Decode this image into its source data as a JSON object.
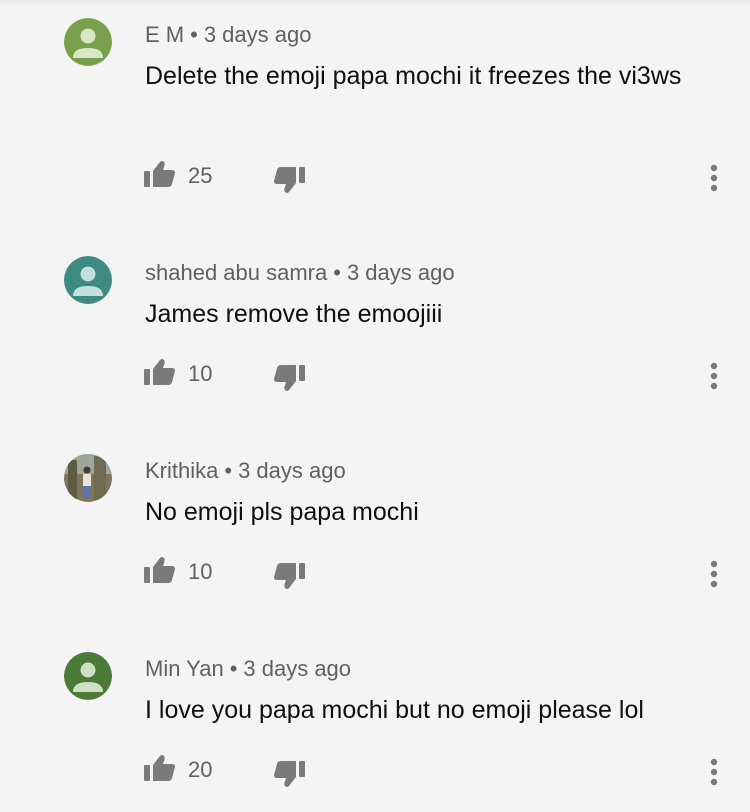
{
  "comments": [
    {
      "author": "E M",
      "time": "3 days ago",
      "text": "Delete the emoji papa mochi it freezes the vi3ws",
      "likes": "25",
      "avatar_color": "#79a04a"
    },
    {
      "author": "shahed abu samra",
      "time": "3 days ago",
      "text": "James remove the emoojiii",
      "likes": "10",
      "avatar_color": "#3f8a82"
    },
    {
      "author": "Krithika",
      "time": "3 days ago",
      "text": "No emoji pls papa mochi",
      "likes": "10",
      "avatar_color": "#8a7a60"
    },
    {
      "author": "Min Yan",
      "time": "3 days ago",
      "text": "I love you papa mochi but no emoji please lol",
      "likes": "20",
      "avatar_color": "#4a7a35"
    }
  ],
  "separator": "•",
  "icons": {
    "like": "thumb-up-icon",
    "dislike": "thumb-down-icon",
    "more": "more-vert-icon"
  }
}
